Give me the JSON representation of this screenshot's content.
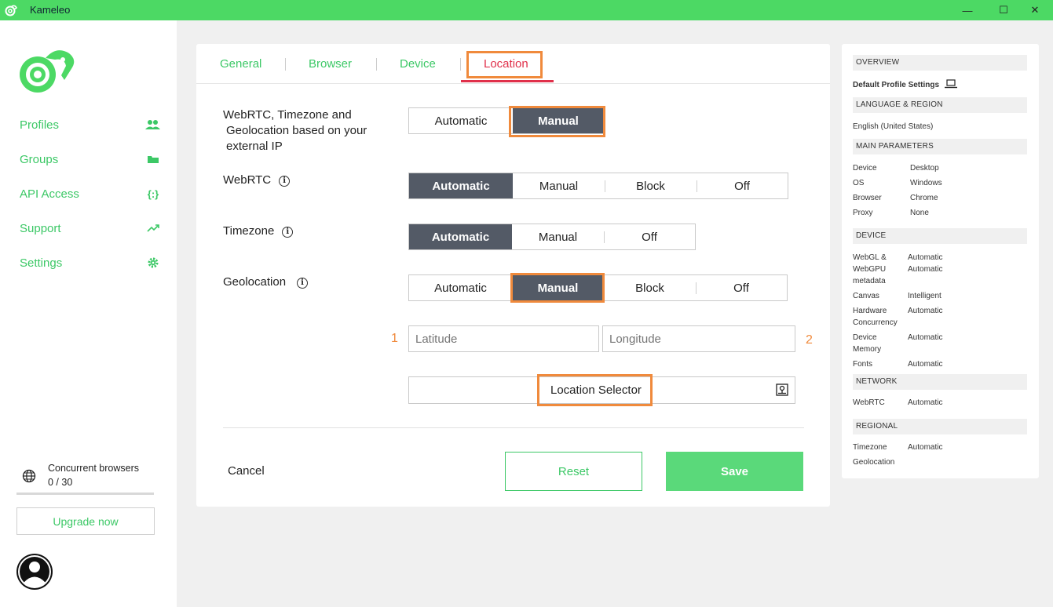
{
  "window": {
    "title": "Kameleo",
    "minimize": "—",
    "maximize": "☐",
    "close": "✕"
  },
  "sidebar": {
    "nav": [
      {
        "label": "Profiles",
        "icon": "users-icon"
      },
      {
        "label": "Groups",
        "icon": "folder-icon"
      },
      {
        "label": "API Access",
        "icon": "braces-icon"
      },
      {
        "label": "Support",
        "icon": "trend-icon"
      },
      {
        "label": "Settings",
        "icon": "gear-icon"
      }
    ],
    "api_icon_text": "{:}",
    "concurrent_label": "Concurrent browsers",
    "concurrent_count": "0 / 30",
    "upgrade_label": "Upgrade now"
  },
  "tabs": [
    "General",
    "Browser",
    "Device",
    "Location"
  ],
  "form": {
    "webrtc_tz_geo": {
      "label_line1": "WebRTC, Timezone and",
      "label_line2": "Geolocation based on your",
      "label_line3": "external IP",
      "options": [
        "Automatic",
        "Manual"
      ],
      "selected": "Manual"
    },
    "webrtc": {
      "label": "WebRTC",
      "options": [
        "Automatic",
        "Manual",
        "Block",
        "Off"
      ],
      "selected": "Automatic"
    },
    "timezone": {
      "label": "Timezone",
      "options": [
        "Automatic",
        "Manual",
        "Off"
      ],
      "selected": "Automatic"
    },
    "geolocation": {
      "label": "Geolocation",
      "options": [
        "Automatic",
        "Manual",
        "Block",
        "Off"
      ],
      "selected": "Manual"
    },
    "latitude_placeholder": "Latitude",
    "longitude_placeholder": "Longitude",
    "marker_1": "1",
    "marker_2": "2",
    "location_selector": "Location Selector",
    "info_glyph": "i"
  },
  "actions": {
    "cancel": "Cancel",
    "reset": "Reset",
    "save": "Save"
  },
  "overview": {
    "overview_title": "OVERVIEW",
    "default_settings": "Default Profile Settings",
    "lang_title": "LANGUAGE & REGION",
    "language": "English (United States)",
    "main_title": "MAIN PARAMETERS",
    "main": [
      {
        "k": "Device",
        "v": "Desktop"
      },
      {
        "k": "OS",
        "v": "Windows"
      },
      {
        "k": "Browser",
        "v": "Chrome"
      },
      {
        "k": "Proxy",
        "v": "None"
      }
    ],
    "device_title": "DEVICE",
    "webgl_k1": "WebGL &",
    "webgl_k2": "WebGPU",
    "webgl_k3": "metadata",
    "webgl_v1": "Automatic",
    "webgl_v2": "Automatic",
    "canvas_k": "Canvas",
    "canvas_v": "Intelligent",
    "hw_k1": "Hardware",
    "hw_k2": "Concurrency",
    "hw_v": "Automatic",
    "mem_k1": "Device",
    "mem_k2": "Memory",
    "mem_v": "Automatic",
    "fonts_k": "Fonts",
    "fonts_v": "Automatic",
    "network_title": "NETWORK",
    "webrtc_k": "WebRTC",
    "webrtc_v": "Automatic",
    "regional_title": "REGIONAL",
    "timezone_k": "Timezone",
    "timezone_v": "Automatic",
    "geolocation_k": "Geolocation"
  },
  "colors": {
    "accent": "#3cc866",
    "titlebar": "#4cd964",
    "selected_segment": "#535a66",
    "highlight": "#f08a3c",
    "active_tab": "#e0304a"
  }
}
